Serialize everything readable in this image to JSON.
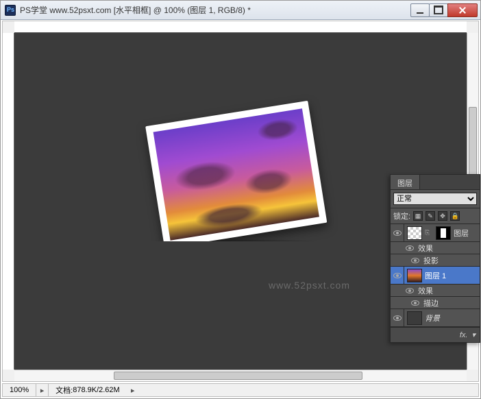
{
  "titlebar": {
    "text": "PS学堂 www.52psxt.com [水平相框] @ 100% (图层 1, RGB/8) *"
  },
  "statusbar": {
    "zoom": "100%",
    "doc_label": "文档:",
    "doc_size": "878.9K/2.62M"
  },
  "watermark": "www.52psxt.com",
  "layers_panel": {
    "tab": "图层",
    "blend_mode": "正常",
    "lock_label": "锁定:",
    "layer0": {
      "name": "图层"
    },
    "layer0_fx": "效果",
    "layer0_fx1": "投影",
    "layer1": {
      "name": "图层 1"
    },
    "layer1_fx": "效果",
    "layer1_fx1": "描边",
    "layer_bg": {
      "name": "背景"
    },
    "footer_fx": "fx."
  }
}
